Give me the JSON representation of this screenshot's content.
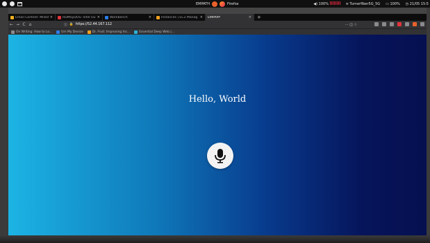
{
  "os_bar": {
    "center_app": "EMPATH",
    "center_browser": "Firefox",
    "volume": "100%",
    "wifi": "Turnerfiber5G_5G",
    "battery": "100%",
    "clock": "21/05  15:5"
  },
  "tabs": [
    {
      "title": "Email Context: Milestone",
      "favicon_color": "#f2b01e"
    },
    {
      "title": "RDMSyDOS: Intel Ou.St",
      "favicon_color": "#e0343b"
    },
    {
      "title": "Workbench",
      "favicon_color": "#2c7be5"
    },
    {
      "title": "Instances | EC2 Manag",
      "favicon_color": "#f0a020"
    },
    {
      "title": "EMPAPP",
      "favicon_color": "#7a7a7a",
      "active": true
    }
  ],
  "nav": {
    "url": "https://52.44.167.112",
    "back": "←",
    "forward": "→",
    "reload": "C",
    "home": "⌂",
    "more": "···",
    "bookmark_star": "☆",
    "new_tab": "+"
  },
  "bookmarks": [
    {
      "label": "On Writing: How to Lo..."
    },
    {
      "label": "Um My Device"
    },
    {
      "label": "Dr. Fruit: Improving Inc..."
    },
    {
      "label": "Essential Deep Web |..."
    }
  ],
  "page": {
    "heading": "Hello, World",
    "mic_icon": "microphone-icon"
  },
  "colors": {
    "gradient_start": "#1cb4e4",
    "gradient_end": "#051050",
    "text": "#ffffff"
  }
}
